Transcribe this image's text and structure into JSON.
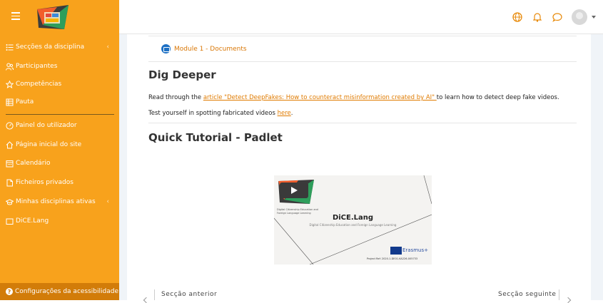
{
  "header": {
    "brand_colors": {
      "accent": "#f8a21c",
      "dark_accent": "#d27c09",
      "link": "#e07b00"
    },
    "icons": [
      "menu-icon",
      "language-icon",
      "notifications-icon",
      "messages-icon",
      "user-avatar",
      "user-menu-caret"
    ]
  },
  "sidebar": {
    "items": [
      {
        "label": "Secções da disciplina",
        "icon": "list-icon"
      },
      {
        "label": "Participantes",
        "icon": "people-icon"
      },
      {
        "label": "Competências",
        "icon": "star-icon"
      },
      {
        "label": "Pauta",
        "icon": "grades-icon"
      },
      {
        "label": "Painel do utilizador",
        "icon": "dashboard-icon"
      },
      {
        "label": "Página inicial do site",
        "icon": "home-icon"
      },
      {
        "label": "Calendário",
        "icon": "calendar-icon"
      },
      {
        "label": "Ficheiros privados",
        "icon": "file-icon"
      },
      {
        "label": "Minhas disciplinas ativas",
        "icon": "graduation-cap-icon"
      },
      {
        "label": "DiCE.Lang",
        "icon": "folder-icon"
      }
    ],
    "accessibility": "Configurações da acessibilidade"
  },
  "main": {
    "module_link": "Module 1 - Documents",
    "section1_title": "Dig Deeper",
    "para1_prefix": "Read through the ",
    "para1_link": "article \"Detect DeepFakes: How to counteract misinformation created by AI\" ",
    "para1_suffix": "to learn how to detect deep fake videos.",
    "para2_prefix": "Test yourself in spotting fabricated videos ",
    "para2_link": "here",
    "para2_suffix": ".",
    "section2_title": "Quick Tutorial - Padlet",
    "video": {
      "title": "DiCE.Lang",
      "subtitle": "Digital Citizenship Education and Foreign Language Learning",
      "small_text": "Digital Citizenship Education and Foreign Language Learning",
      "erasmus": "Erasmus+",
      "ref": "Project Ref: 2020-1-DE01-KA226-005733"
    }
  },
  "nav": {
    "prev": "Secção anterior",
    "next": "Secção seguinte"
  }
}
